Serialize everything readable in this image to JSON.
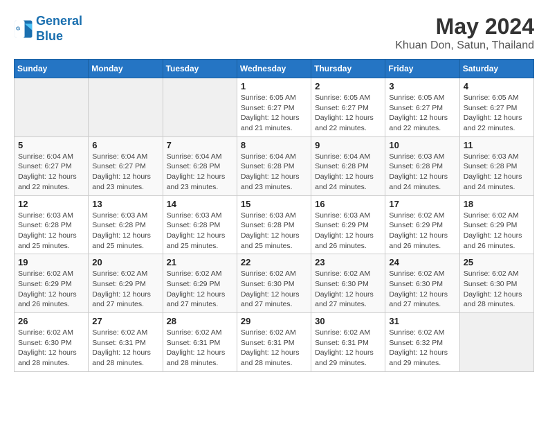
{
  "logo": {
    "line1": "General",
    "line2": "Blue"
  },
  "title": "May 2024",
  "subtitle": "Khuan Don, Satun, Thailand",
  "weekdays": [
    "Sunday",
    "Monday",
    "Tuesday",
    "Wednesday",
    "Thursday",
    "Friday",
    "Saturday"
  ],
  "weeks": [
    [
      {
        "day": "",
        "info": ""
      },
      {
        "day": "",
        "info": ""
      },
      {
        "day": "",
        "info": ""
      },
      {
        "day": "1",
        "sunrise": "6:05 AM",
        "sunset": "6:27 PM",
        "daylight": "12 hours and 21 minutes."
      },
      {
        "day": "2",
        "sunrise": "6:05 AM",
        "sunset": "6:27 PM",
        "daylight": "12 hours and 22 minutes."
      },
      {
        "day": "3",
        "sunrise": "6:05 AM",
        "sunset": "6:27 PM",
        "daylight": "12 hours and 22 minutes."
      },
      {
        "day": "4",
        "sunrise": "6:05 AM",
        "sunset": "6:27 PM",
        "daylight": "12 hours and 22 minutes."
      }
    ],
    [
      {
        "day": "5",
        "sunrise": "6:04 AM",
        "sunset": "6:27 PM",
        "daylight": "12 hours and 22 minutes."
      },
      {
        "day": "6",
        "sunrise": "6:04 AM",
        "sunset": "6:27 PM",
        "daylight": "12 hours and 23 minutes."
      },
      {
        "day": "7",
        "sunrise": "6:04 AM",
        "sunset": "6:28 PM",
        "daylight": "12 hours and 23 minutes."
      },
      {
        "day": "8",
        "sunrise": "6:04 AM",
        "sunset": "6:28 PM",
        "daylight": "12 hours and 23 minutes."
      },
      {
        "day": "9",
        "sunrise": "6:04 AM",
        "sunset": "6:28 PM",
        "daylight": "12 hours and 24 minutes."
      },
      {
        "day": "10",
        "sunrise": "6:03 AM",
        "sunset": "6:28 PM",
        "daylight": "12 hours and 24 minutes."
      },
      {
        "day": "11",
        "sunrise": "6:03 AM",
        "sunset": "6:28 PM",
        "daylight": "12 hours and 24 minutes."
      }
    ],
    [
      {
        "day": "12",
        "sunrise": "6:03 AM",
        "sunset": "6:28 PM",
        "daylight": "12 hours and 25 minutes."
      },
      {
        "day": "13",
        "sunrise": "6:03 AM",
        "sunset": "6:28 PM",
        "daylight": "12 hours and 25 minutes."
      },
      {
        "day": "14",
        "sunrise": "6:03 AM",
        "sunset": "6:28 PM",
        "daylight": "12 hours and 25 minutes."
      },
      {
        "day": "15",
        "sunrise": "6:03 AM",
        "sunset": "6:28 PM",
        "daylight": "12 hours and 25 minutes."
      },
      {
        "day": "16",
        "sunrise": "6:03 AM",
        "sunset": "6:29 PM",
        "daylight": "12 hours and 26 minutes."
      },
      {
        "day": "17",
        "sunrise": "6:02 AM",
        "sunset": "6:29 PM",
        "daylight": "12 hours and 26 minutes."
      },
      {
        "day": "18",
        "sunrise": "6:02 AM",
        "sunset": "6:29 PM",
        "daylight": "12 hours and 26 minutes."
      }
    ],
    [
      {
        "day": "19",
        "sunrise": "6:02 AM",
        "sunset": "6:29 PM",
        "daylight": "12 hours and 26 minutes."
      },
      {
        "day": "20",
        "sunrise": "6:02 AM",
        "sunset": "6:29 PM",
        "daylight": "12 hours and 27 minutes."
      },
      {
        "day": "21",
        "sunrise": "6:02 AM",
        "sunset": "6:29 PM",
        "daylight": "12 hours and 27 minutes."
      },
      {
        "day": "22",
        "sunrise": "6:02 AM",
        "sunset": "6:30 PM",
        "daylight": "12 hours and 27 minutes."
      },
      {
        "day": "23",
        "sunrise": "6:02 AM",
        "sunset": "6:30 PM",
        "daylight": "12 hours and 27 minutes."
      },
      {
        "day": "24",
        "sunrise": "6:02 AM",
        "sunset": "6:30 PM",
        "daylight": "12 hours and 27 minutes."
      },
      {
        "day": "25",
        "sunrise": "6:02 AM",
        "sunset": "6:30 PM",
        "daylight": "12 hours and 28 minutes."
      }
    ],
    [
      {
        "day": "26",
        "sunrise": "6:02 AM",
        "sunset": "6:30 PM",
        "daylight": "12 hours and 28 minutes."
      },
      {
        "day": "27",
        "sunrise": "6:02 AM",
        "sunset": "6:31 PM",
        "daylight": "12 hours and 28 minutes."
      },
      {
        "day": "28",
        "sunrise": "6:02 AM",
        "sunset": "6:31 PM",
        "daylight": "12 hours and 28 minutes."
      },
      {
        "day": "29",
        "sunrise": "6:02 AM",
        "sunset": "6:31 PM",
        "daylight": "12 hours and 28 minutes."
      },
      {
        "day": "30",
        "sunrise": "6:02 AM",
        "sunset": "6:31 PM",
        "daylight": "12 hours and 29 minutes."
      },
      {
        "day": "31",
        "sunrise": "6:02 AM",
        "sunset": "6:32 PM",
        "daylight": "12 hours and 29 minutes."
      },
      {
        "day": "",
        "info": ""
      }
    ]
  ],
  "labels": {
    "sunrise_prefix": "Sunrise: ",
    "sunset_prefix": "Sunset: ",
    "daylight_prefix": "Daylight: "
  }
}
